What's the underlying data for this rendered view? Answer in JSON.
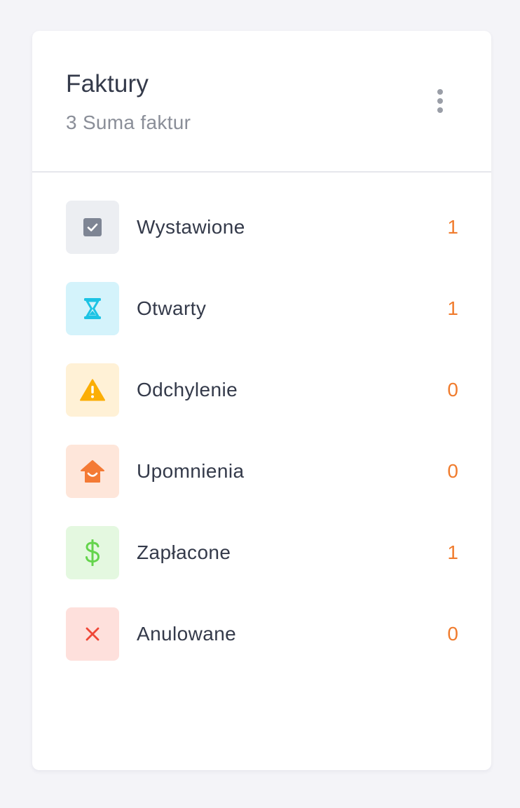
{
  "header": {
    "title": "Faktury",
    "subtitle": "3 Suma faktur",
    "more_icon": "more-vertical-icon"
  },
  "statuses": [
    {
      "label": "Wystawione",
      "count": "1",
      "icon": "check-square-icon",
      "bg": "#eceef2",
      "fg": "#7e8594"
    },
    {
      "label": "Otwarty",
      "count": "1",
      "icon": "hourglass-icon",
      "bg": "#d4f3fb",
      "fg": "#1cc3e4"
    },
    {
      "label": "Odchylenie",
      "count": "0",
      "icon": "warning-triangle-icon",
      "bg": "#fff1d6",
      "fg": "#fbae05"
    },
    {
      "label": "Upomnienia",
      "count": "0",
      "icon": "reminder-house-icon",
      "bg": "#fee6da",
      "fg": "#f47a35"
    },
    {
      "label": "Zapłacone",
      "count": "1",
      "icon": "dollar-icon",
      "bg": "#e4f8e0",
      "fg": "#64d44c"
    },
    {
      "label": "Anulowane",
      "count": "0",
      "icon": "close-icon",
      "bg": "#fee0dc",
      "fg": "#ef4637"
    }
  ],
  "colors": {
    "count": "#f07c2e",
    "text": "#343a4a",
    "muted": "#8a8e98"
  }
}
